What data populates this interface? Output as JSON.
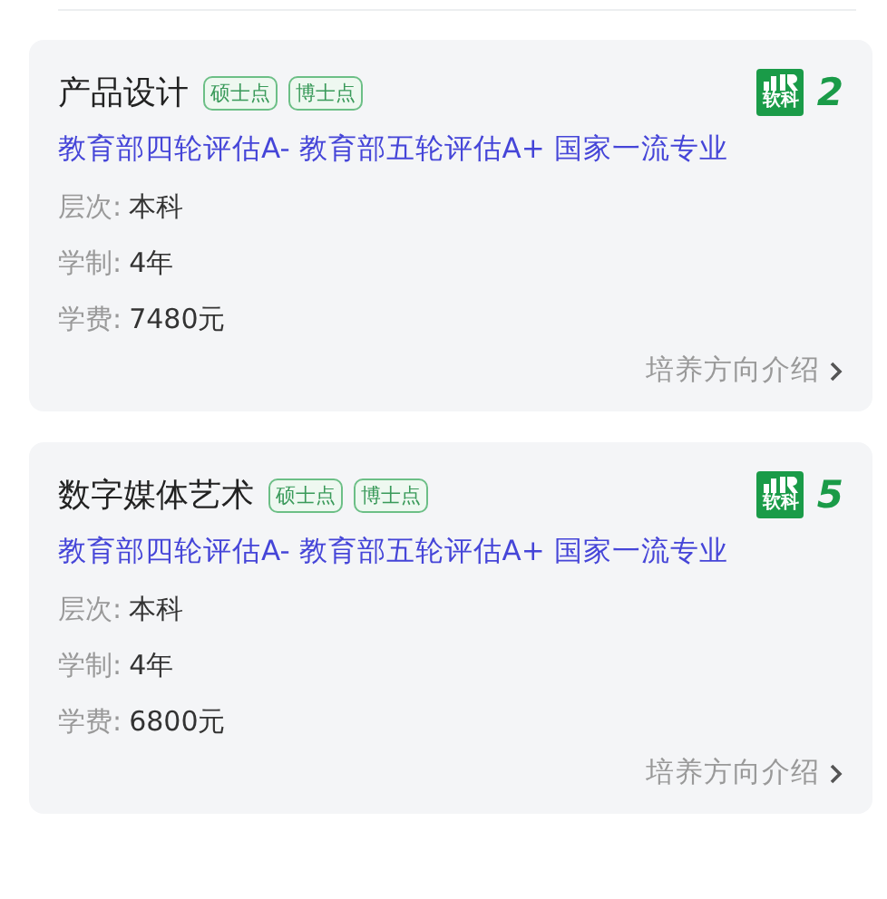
{
  "majors": [
    {
      "name": "产品设计",
      "tags": [
        "硕士点",
        "博士点"
      ],
      "rank_logo": "软科",
      "rank": "2",
      "evaluation": "教育部四轮评估A- 教育部五轮评估A+ 国家一流专业",
      "fields": [
        {
          "label": "层次:",
          "value": "本科"
        },
        {
          "label": "学制:",
          "value": "4年"
        },
        {
          "label": "学费:",
          "value": "7480元"
        }
      ],
      "link": "培养方向介绍"
    },
    {
      "name": "数字媒体艺术",
      "tags": [
        "硕士点",
        "博士点"
      ],
      "rank_logo": "软科",
      "rank": "5",
      "evaluation": "教育部四轮评估A- 教育部五轮评估A+ 国家一流专业",
      "fields": [
        {
          "label": "层次:",
          "value": "本科"
        },
        {
          "label": "学制:",
          "value": "4年"
        },
        {
          "label": "学费:",
          "value": "6800元"
        }
      ],
      "link": "培养方向介绍"
    }
  ]
}
